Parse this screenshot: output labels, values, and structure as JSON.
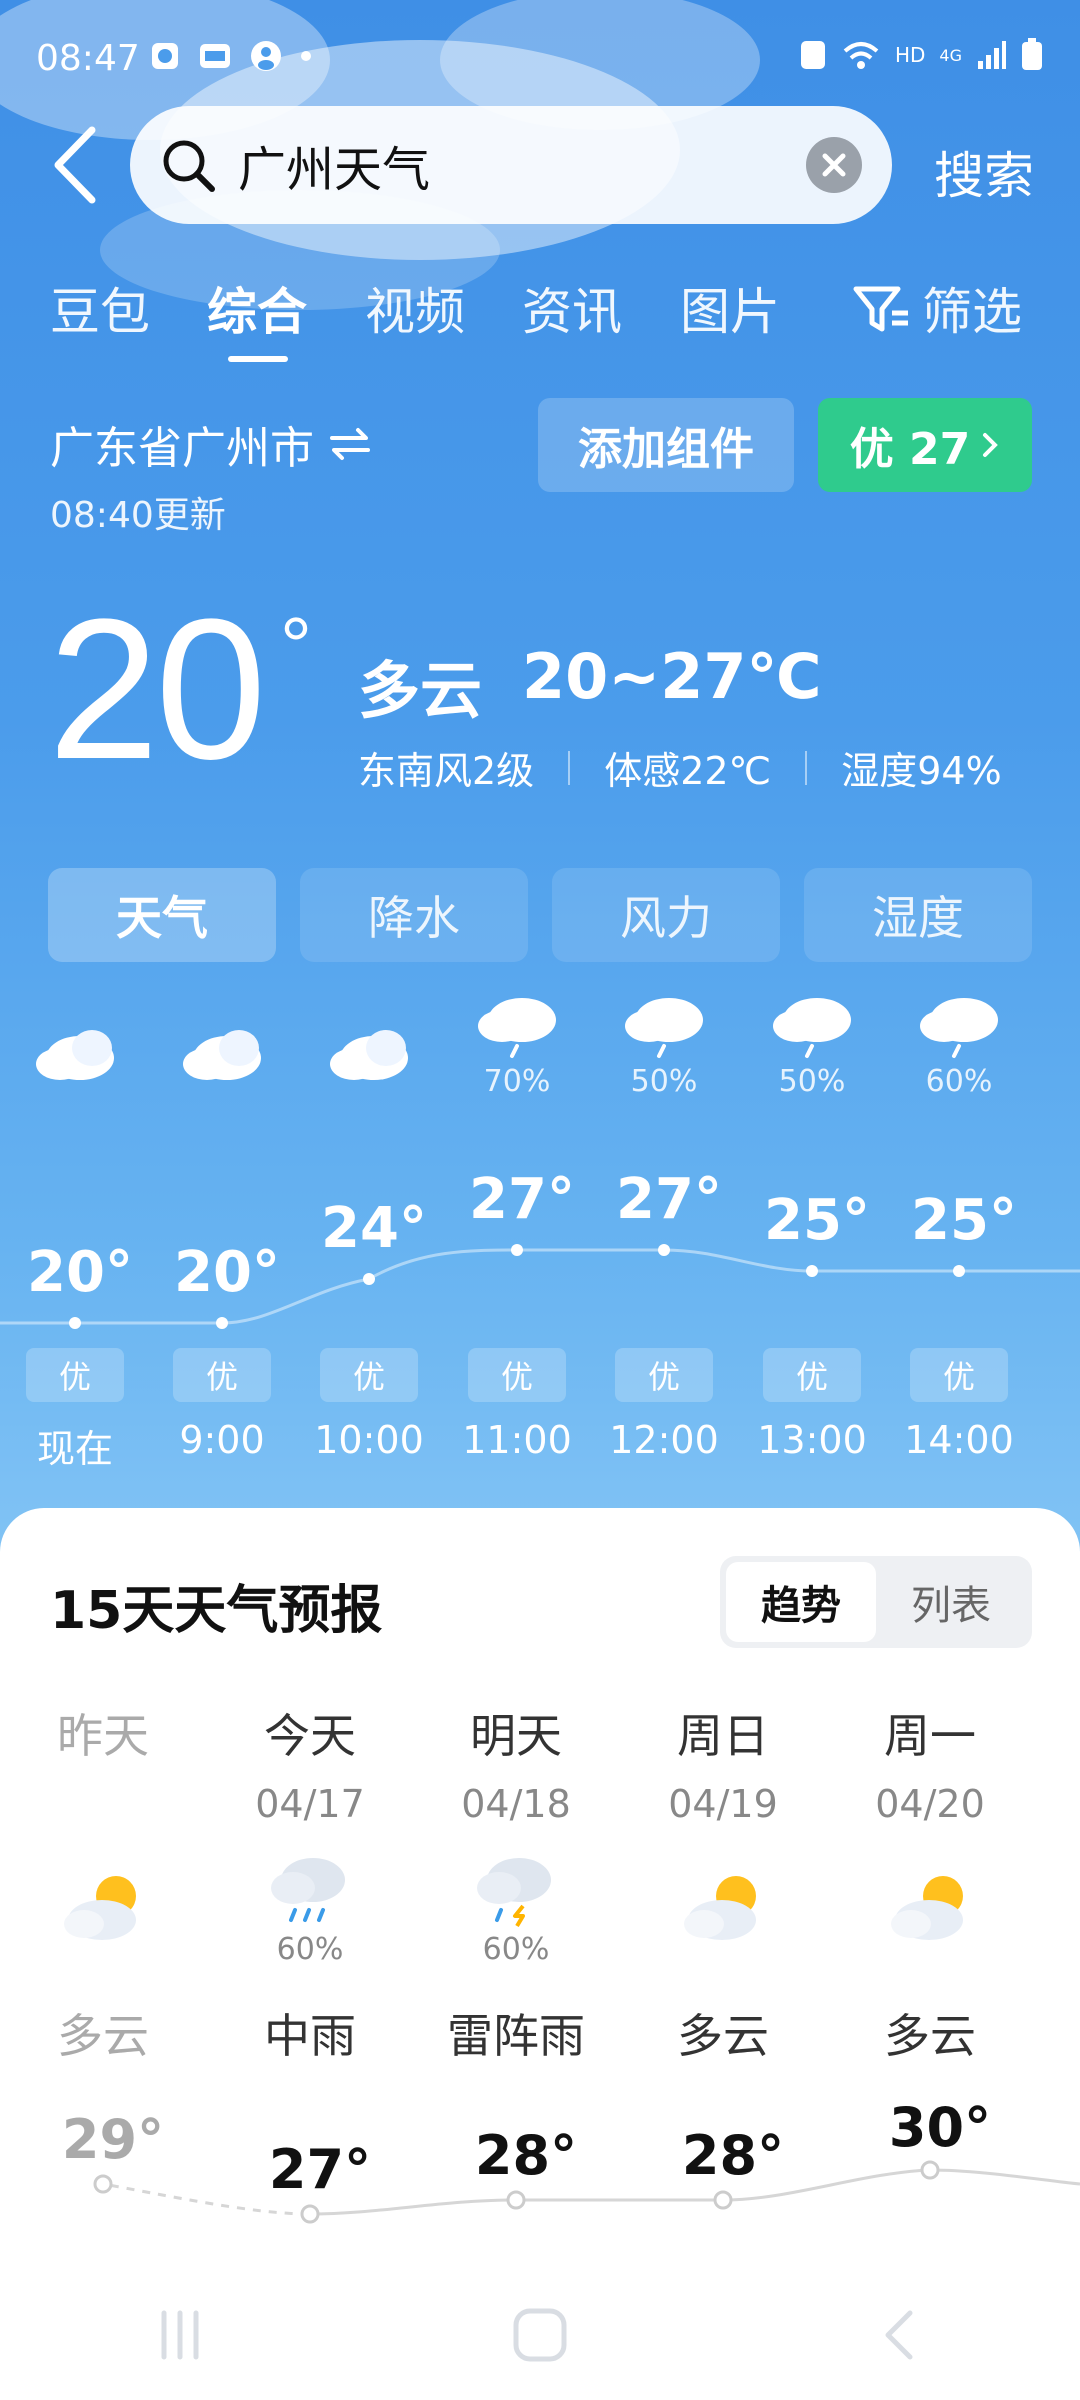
{
  "status_bar": {
    "time": "08:47",
    "network": "4G",
    "hd": "HD"
  },
  "search": {
    "query": "广州天气",
    "submit_label": "搜索"
  },
  "tabs": [
    {
      "label": "豆包"
    },
    {
      "label": "综合"
    },
    {
      "label": "视频"
    },
    {
      "label": "资讯"
    },
    {
      "label": "图片"
    },
    {
      "label": "筛选"
    }
  ],
  "location": {
    "name": "广东省广州市",
    "updated": "08:40更新"
  },
  "actions": {
    "add_widget": "添加组件",
    "aqi": "优 27"
  },
  "current": {
    "temp": "20",
    "degree": "°",
    "condition": "多云",
    "range": "20~27℃",
    "wind": "东南风2级",
    "feels_like": "体感22℃",
    "humidity": "湿度94%"
  },
  "segments": [
    {
      "label": "天气"
    },
    {
      "label": "降水"
    },
    {
      "label": "风力"
    },
    {
      "label": "湿度"
    }
  ],
  "hourly": [
    {
      "time": "现在",
      "temp": "20°",
      "aqi": "优",
      "precip": "",
      "icon": "cloud-icon"
    },
    {
      "time": "9:00",
      "temp": "20°",
      "aqi": "优",
      "precip": "",
      "icon": "cloud-icon"
    },
    {
      "time": "10:00",
      "temp": "24°",
      "aqi": "优",
      "precip": "",
      "icon": "cloud-icon"
    },
    {
      "time": "11:00",
      "temp": "27°",
      "aqi": "优",
      "precip": "70%",
      "icon": "rain-cloud-icon"
    },
    {
      "time": "12:00",
      "temp": "27°",
      "aqi": "优",
      "precip": "50%",
      "icon": "rain-cloud-icon"
    },
    {
      "time": "13:00",
      "temp": "25°",
      "aqi": "优",
      "precip": "50%",
      "icon": "rain-cloud-icon"
    },
    {
      "time": "14:00",
      "temp": "25°",
      "aqi": "优",
      "precip": "60%",
      "icon": "rain-cloud-icon"
    }
  ],
  "forecast": {
    "title": "15天天气预报",
    "toggle": {
      "trend": "趋势",
      "list": "列表"
    },
    "days": [
      {
        "name": "昨天",
        "date": "",
        "precip": "",
        "condition": "多云",
        "high": "29°",
        "icon": "partly-cloudy-icon"
      },
      {
        "name": "今天",
        "date": "04/17",
        "precip": "60%",
        "condition": "中雨",
        "high": "27°",
        "icon": "rain-cloud-icon"
      },
      {
        "name": "明天",
        "date": "04/18",
        "precip": "60%",
        "condition": "雷阵雨",
        "high": "28°",
        "icon": "thunder-rain-icon"
      },
      {
        "name": "周日",
        "date": "04/19",
        "precip": "",
        "condition": "多云",
        "high": "28°",
        "icon": "partly-cloudy-icon"
      },
      {
        "name": "周一",
        "date": "04/20",
        "precip": "",
        "condition": "多云",
        "high": "30°",
        "icon": "partly-cloudy-icon"
      }
    ]
  },
  "colors": {
    "aqi_good": "#2fcb8d",
    "sky": "#4b9ceb",
    "sun": "#ffc01e"
  }
}
